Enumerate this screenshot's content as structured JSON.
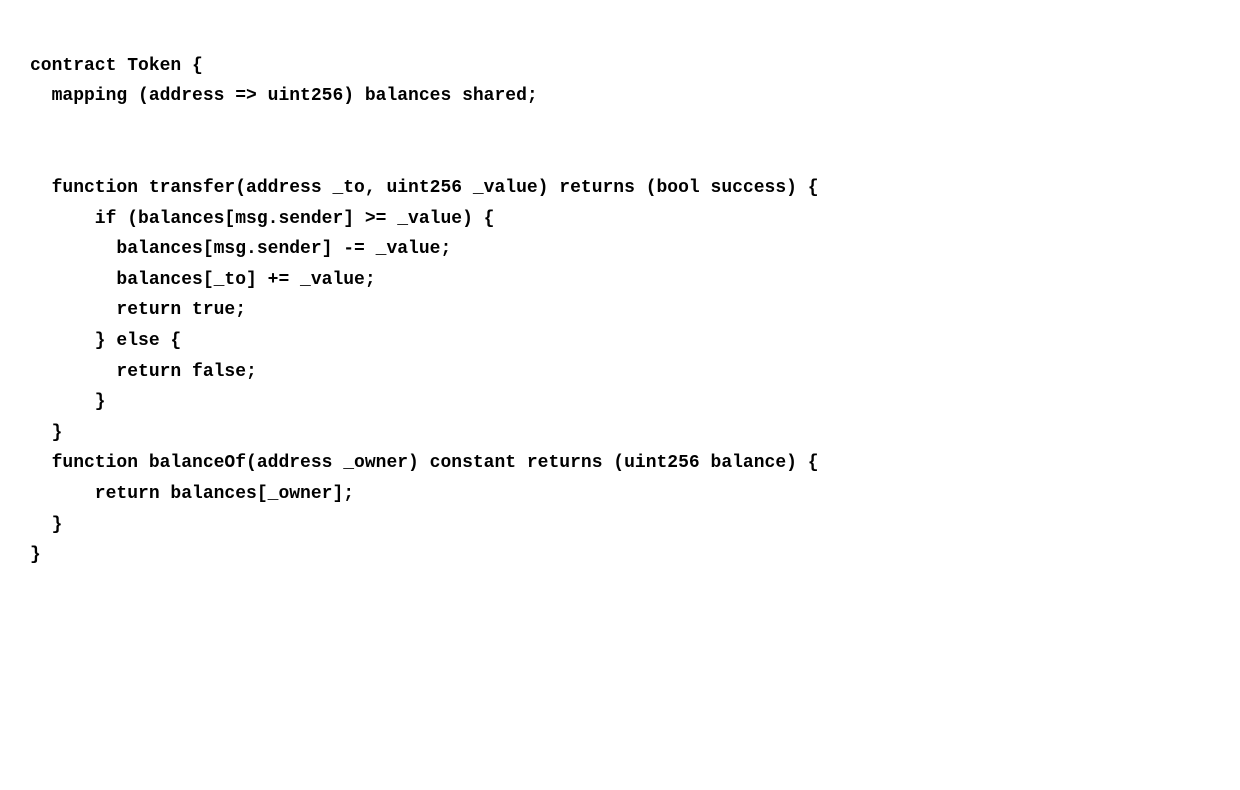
{
  "code": {
    "lines": [
      "contract Token {",
      "  mapping (address => uint256) balances shared;",
      "",
      "",
      "  function transfer(address _to, uint256 _value) returns (bool success) {",
      "      if (balances[msg.sender] >= _value) {",
      "        balances[msg.sender] -= _value;",
      "        balances[_to] += _value;",
      "        return true;",
      "      } else {",
      "        return false;",
      "      }",
      "  }",
      "  function balanceOf(address _owner) constant returns (uint256 balance) {",
      "      return balances[_owner];",
      "  }",
      "}"
    ]
  }
}
